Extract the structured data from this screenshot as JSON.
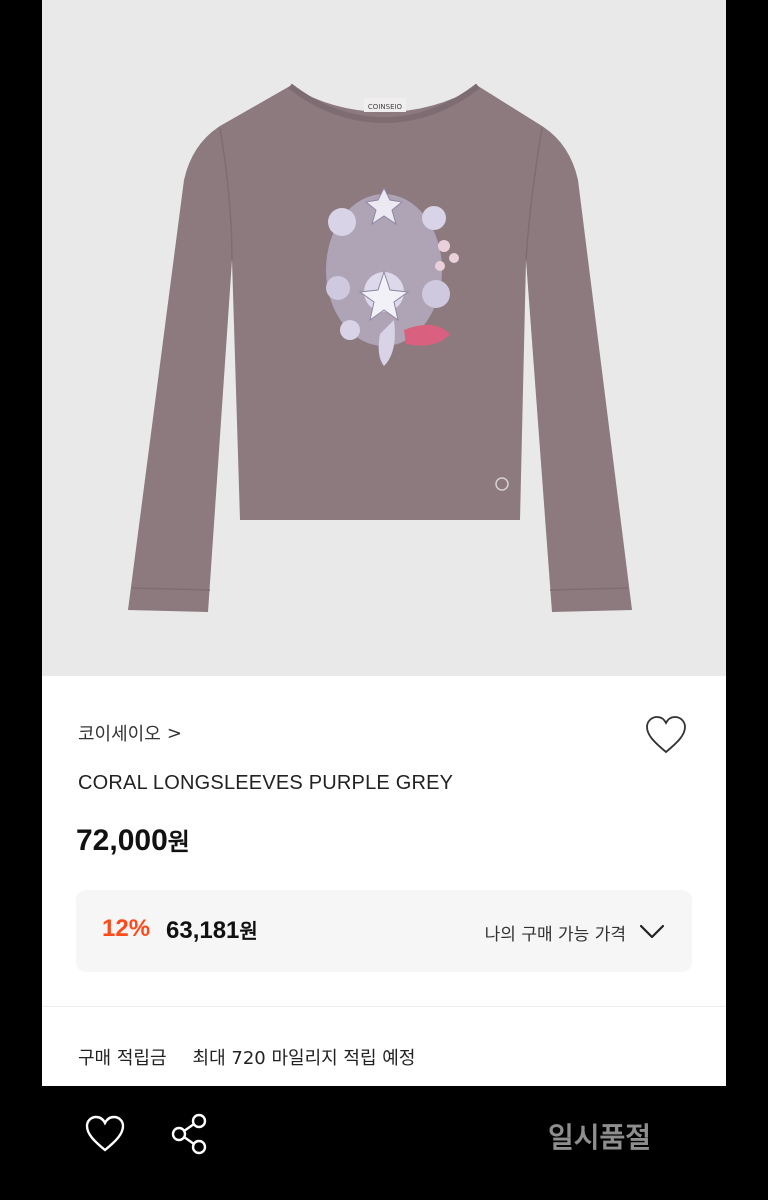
{
  "product": {
    "brand": "코이세이오",
    "brand_chevron": ">",
    "name": "CORAL LONGSLEEVES PURPLE GREY",
    "price_number": "72,000",
    "price_unit": "원"
  },
  "discount": {
    "rate": "12%",
    "price_number": "63,181",
    "price_unit": "원",
    "my_price_label": "나의 구매 가능 가격"
  },
  "points": {
    "label": "구매 적립금",
    "value": "최대 720 마일리지 적립 예정"
  },
  "bottom_bar": {
    "status_label": "일시품절"
  },
  "image": {
    "neck_label_text": "COINSEIO",
    "shirt_color": "#8c7a7f",
    "background_color": "#e9e9e9"
  },
  "colors": {
    "discount_rate": "#ff4a1c",
    "soldout_text": "#8e8e8e"
  },
  "icons": {
    "wishlist": "heart-outline-icon",
    "my_price_toggle": "chevron-down-icon",
    "bottom_like": "heart-outline-icon",
    "share": "share-icon"
  }
}
